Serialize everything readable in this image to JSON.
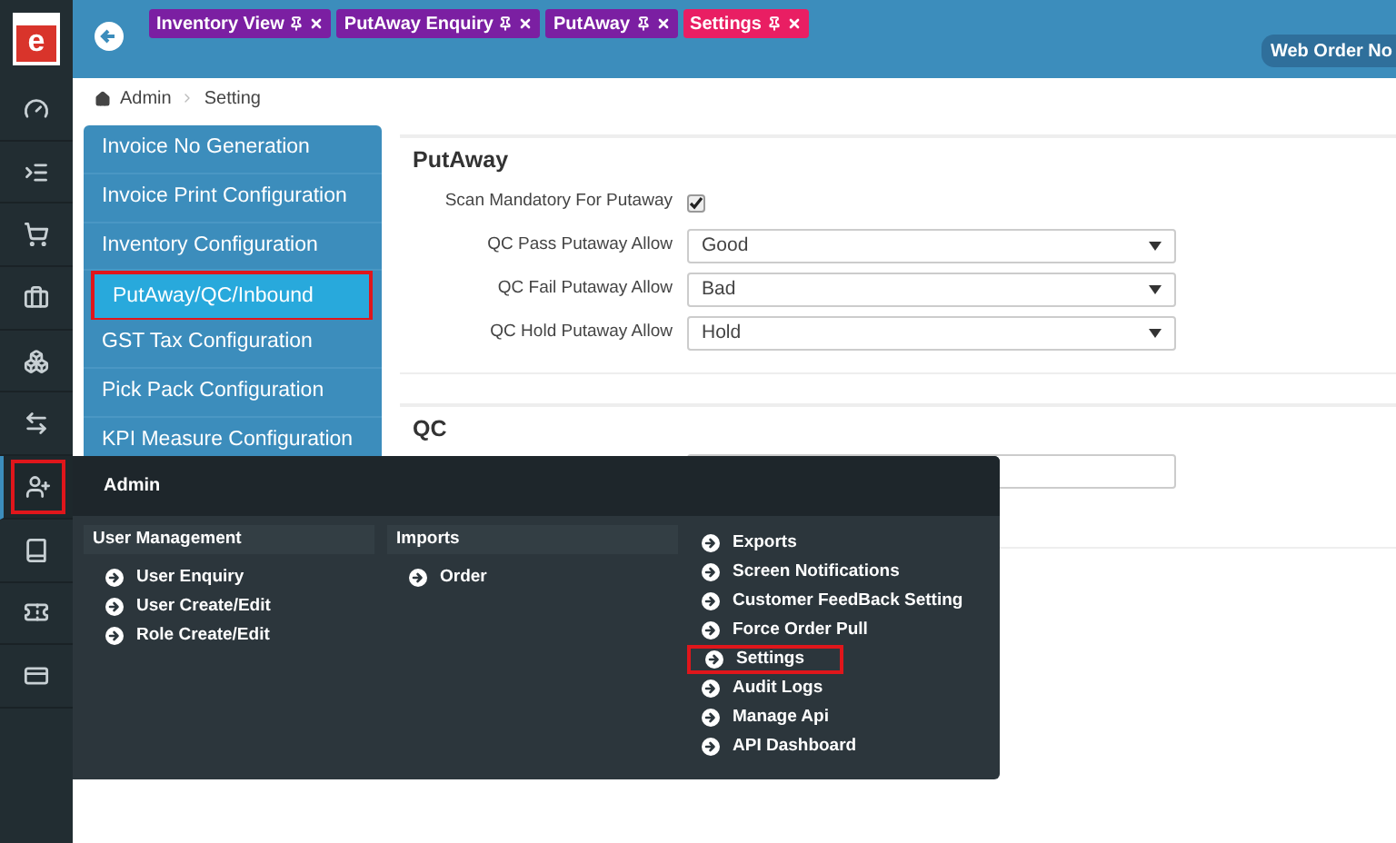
{
  "logo": {
    "letter": "e"
  },
  "tabs": [
    {
      "label": "Inventory View",
      "selected": false
    },
    {
      "label": "PutAway Enquiry",
      "selected": false
    },
    {
      "label": "PutAway",
      "selected": false
    },
    {
      "label": "Settings",
      "selected": true
    }
  ],
  "header_button": "Web Order No",
  "sidebar": {
    "items": [
      {
        "kind": "gauge",
        "selected": false
      },
      {
        "kind": "list",
        "selected": false
      },
      {
        "kind": "cart",
        "selected": false
      },
      {
        "kind": "bag",
        "selected": false
      },
      {
        "kind": "cubes",
        "selected": false
      },
      {
        "kind": "exchange",
        "selected": false
      },
      {
        "kind": "user-plus",
        "selected": true
      },
      {
        "kind": "book",
        "selected": false
      },
      {
        "kind": "ticket",
        "selected": false
      },
      {
        "kind": "card",
        "selected": false
      }
    ]
  },
  "breadcrumb": [
    "Admin",
    "Setting"
  ],
  "settings_menu": [
    {
      "label": "Invoice No Generation",
      "selected": false
    },
    {
      "label": "Invoice Print Configuration",
      "selected": false
    },
    {
      "label": "Inventory Configuration",
      "selected": false
    },
    {
      "label": "PutAway/QC/Inbound",
      "selected": true
    },
    {
      "label": "GST Tax Configuration",
      "selected": false
    },
    {
      "label": "Pick Pack Configuration",
      "selected": false
    },
    {
      "label": "KPI Measure Configuration",
      "selected": false
    }
  ],
  "putaway": {
    "title": "PutAway",
    "fields": [
      {
        "kind": "checkbox",
        "label": "Scan Mandatory For Putaway",
        "checked": true
      },
      {
        "kind": "select",
        "label": "QC Pass Putaway Allow",
        "value": "Good"
      },
      {
        "kind": "select",
        "label": "QC Fail Putaway Allow",
        "value": "Bad"
      },
      {
        "kind": "select",
        "label": "QC Hold Putaway Allow",
        "value": "Hold"
      }
    ]
  },
  "qc": {
    "title": "QC"
  },
  "admin_menu": {
    "title": "Admin",
    "columns": [
      {
        "heading": "User Management",
        "links": [
          {
            "label": "User Enquiry",
            "highlighted": false
          },
          {
            "label": "User Create/Edit",
            "highlighted": false
          },
          {
            "label": "Role Create/Edit",
            "highlighted": false
          }
        ]
      },
      {
        "heading": "Imports",
        "links": [
          {
            "label": "Order",
            "highlighted": false
          }
        ]
      },
      {
        "links": [
          {
            "label": "Exports",
            "highlighted": false
          },
          {
            "label": "Screen Notifications",
            "highlighted": false
          },
          {
            "label": "Customer FeedBack Setting",
            "highlighted": false
          },
          {
            "label": "Force Order Pull",
            "highlighted": false
          },
          {
            "label": "Settings",
            "highlighted": true
          },
          {
            "label": "Audit Logs",
            "highlighted": false
          },
          {
            "label": "Manage Api",
            "highlighted": false
          },
          {
            "label": "API Dashboard",
            "highlighted": false
          }
        ]
      }
    ]
  }
}
